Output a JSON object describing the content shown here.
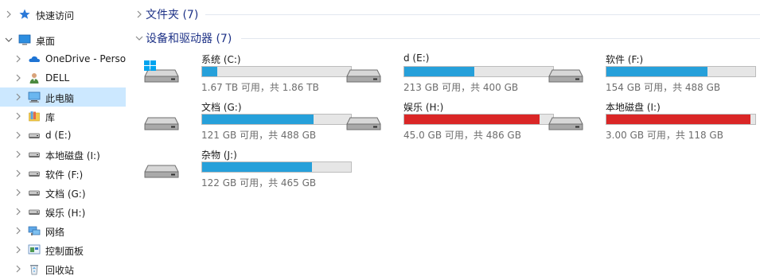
{
  "sidebar": {
    "items": [
      {
        "label": "快速访问",
        "icon": "quick-access-star-icon",
        "expanded": false,
        "selected": false
      },
      {
        "label": "桌面",
        "icon": "desktop-icon",
        "expanded": true,
        "selected": false
      },
      {
        "label": "OneDrive - Person",
        "icon": "onedrive-cloud-icon",
        "expanded": false,
        "selected": false
      },
      {
        "label": "DELL",
        "icon": "user-icon",
        "expanded": false,
        "selected": false
      },
      {
        "label": "此电脑",
        "icon": "this-pc-icon",
        "expanded": false,
        "selected": true
      },
      {
        "label": "库",
        "icon": "library-icon",
        "expanded": false,
        "selected": false
      },
      {
        "label": "d (E:)",
        "icon": "drive-icon",
        "expanded": false,
        "selected": false
      },
      {
        "label": "本地磁盘 (I:)",
        "icon": "drive-icon",
        "expanded": false,
        "selected": false
      },
      {
        "label": "软件 (F:)",
        "icon": "drive-icon",
        "expanded": false,
        "selected": false
      },
      {
        "label": "文档 (G:)",
        "icon": "drive-icon",
        "expanded": false,
        "selected": false
      },
      {
        "label": "娱乐 (H:)",
        "icon": "drive-icon",
        "expanded": false,
        "selected": false
      },
      {
        "label": "网络",
        "icon": "network-icon",
        "expanded": false,
        "selected": false
      },
      {
        "label": "控制面板",
        "icon": "control-panel-icon",
        "expanded": false,
        "selected": false
      },
      {
        "label": "回收站",
        "icon": "recycle-bin-icon",
        "expanded": false,
        "selected": false
      }
    ]
  },
  "main": {
    "folders_group": {
      "title": "文件夹 (7)",
      "expanded": false
    },
    "drives_group": {
      "title": "设备和驱动器 (7)",
      "expanded": true
    },
    "drives": [
      {
        "name": "系统 (C:)",
        "info": "1.67 TB 可用，共 1.86 TB",
        "used_fraction": 0.1,
        "low_space": false,
        "system": true
      },
      {
        "name": "d (E:)",
        "info": "213 GB 可用，共 400 GB",
        "used_fraction": 0.47,
        "low_space": false,
        "system": false
      },
      {
        "name": "软件 (F:)",
        "info": "154 GB 可用，共 488 GB",
        "used_fraction": 0.68,
        "low_space": false,
        "system": false
      },
      {
        "name": "文档 (G:)",
        "info": "121 GB 可用，共 488 GB",
        "used_fraction": 0.75,
        "low_space": false,
        "system": false
      },
      {
        "name": "娱乐 (H:)",
        "info": "45.0 GB 可用，共 486 GB",
        "used_fraction": 0.91,
        "low_space": true,
        "system": false
      },
      {
        "name": "本地磁盘 (I:)",
        "info": "3.00 GB 可用，共 118 GB",
        "used_fraction": 0.97,
        "low_space": true,
        "system": false
      },
      {
        "name": "杂物 (J:)",
        "info": "122 GB 可用，共 465 GB",
        "used_fraction": 0.74,
        "low_space": false,
        "system": false
      }
    ]
  },
  "colors": {
    "bar_normal": "#26a0da",
    "bar_low": "#da2626",
    "selected_bg": "#cce8ff",
    "group_title": "#1e3287"
  }
}
